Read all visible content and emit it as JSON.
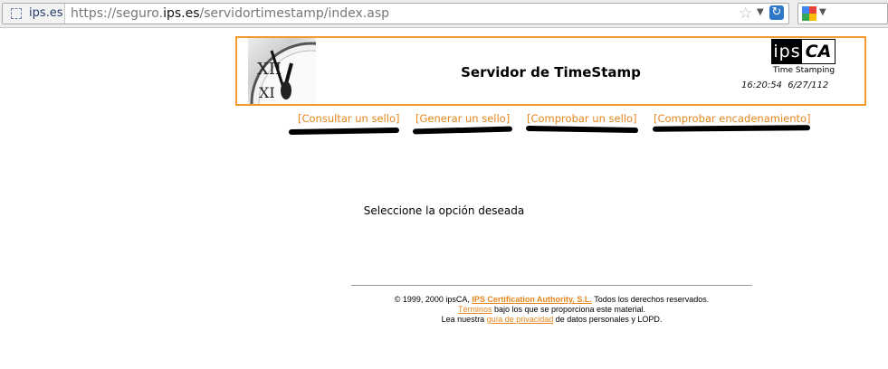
{
  "browser": {
    "site_identity": "ips.es",
    "url_prefix": "https://seguro.",
    "url_host": "ips.es",
    "url_path": "/servidortimestamp/index.asp",
    "icons": [
      "page-icon",
      "bookmark-star-icon",
      "reload-icon",
      "google-search-icon"
    ]
  },
  "header": {
    "title": "Servidor de TimeStamp",
    "logo_left": "ips",
    "logo_right": "CA",
    "logo_subtitle": "Time Stamping",
    "time": "16:20:54",
    "date": "6/27/112"
  },
  "nav": {
    "consultar": "[Consultar un sello]",
    "generar": "[Generar un sello]",
    "comprobar": "[Comprobar un sello]",
    "encadenamiento": "[Comprobar encadenamiento]"
  },
  "main": {
    "prompt": "Seleccione la opción deseada"
  },
  "footer": {
    "copyright_pre": "© 1999, 2000 ipsCA, ",
    "company_link": "IPS Certification Authority, S.L.",
    "copyright_post": " Todos los derechos reservados.",
    "terms_link": "Términos",
    "terms_post": " bajo los que se proporciona este material.",
    "privacy_pre": "Lea nuestra ",
    "privacy_link": "guía de privacidad",
    "privacy_post": " de datos personales y LOPD."
  },
  "colors": {
    "accent_orange": "#f39a2b",
    "link_orange": "#e5861d"
  }
}
